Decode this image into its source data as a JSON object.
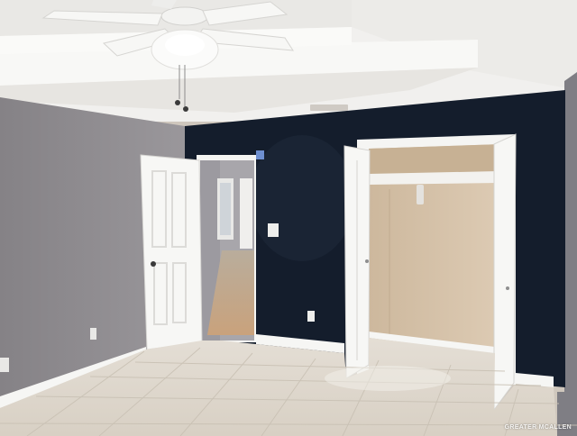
{
  "image": {
    "watermark_text": "GREATER MCALLEN",
    "colors": {
      "ceiling": "#f3f2f0",
      "left_wall": "#8e8b8f",
      "accent_wall": "#141d2c",
      "floor": "#ddd6cb",
      "closet_interior": "#d6c4ad",
      "trim": "#f7f7f5"
    },
    "objects": [
      "ceiling-fan-icon",
      "tray-ceiling",
      "open-entry-door",
      "hallway",
      "light-switch",
      "open-closet-door",
      "closet-shelf",
      "tile-floor"
    ]
  }
}
